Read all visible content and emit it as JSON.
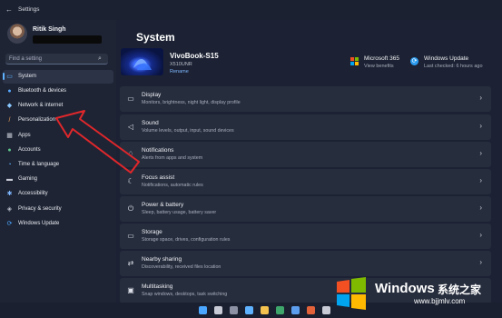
{
  "window": {
    "title": "Settings",
    "back_icon": "back-arrow-icon"
  },
  "user": {
    "name": "Ritik Singh"
  },
  "search": {
    "placeholder": "Find a setting"
  },
  "sidebar": {
    "items": [
      {
        "label": "System",
        "icon": "monitor-icon",
        "color": "#5fb2ff",
        "selected": true
      },
      {
        "label": "Bluetooth & devices",
        "icon": "bluetooth-icon",
        "color": "#59a9ff"
      },
      {
        "label": "Network & internet",
        "icon": "wifi-icon",
        "color": "#8bc7ff"
      },
      {
        "label": "Personalization",
        "icon": "brush-icon",
        "color": "#f2a35a"
      },
      {
        "label": "Apps",
        "icon": "apps-icon",
        "color": "#c8cbd6"
      },
      {
        "label": "Accounts",
        "icon": "person-icon",
        "color": "#5cc48a"
      },
      {
        "label": "Time & language",
        "icon": "globe-clock-icon",
        "color": "#5fb2ff"
      },
      {
        "label": "Gaming",
        "icon": "controller-icon",
        "color": "#c8cbd6"
      },
      {
        "label": "Accessibility",
        "icon": "accessibility-icon",
        "color": "#7fb7ff"
      },
      {
        "label": "Privacy & security",
        "icon": "shield-icon",
        "color": "#b8bcc8"
      },
      {
        "label": "Windows Update",
        "icon": "update-icon",
        "color": "#4aa6ff"
      }
    ]
  },
  "main": {
    "title": "System",
    "device": {
      "name": "VivoBook-S15",
      "model": "X510UNR",
      "rename": "Rename"
    },
    "microsoft365": {
      "title": "Microsoft 365",
      "subtitle": "View benefits"
    },
    "windows_update": {
      "title": "Windows Update",
      "subtitle": "Last checked: 6 hours ago"
    },
    "cards": [
      {
        "title": "Display",
        "subtitle": "Monitors, brightness, night light, display profile",
        "icon": "monitor-icon"
      },
      {
        "title": "Sound",
        "subtitle": "Volume levels, output, input, sound devices",
        "icon": "speaker-icon"
      },
      {
        "title": "Notifications",
        "subtitle": "Alerts from apps and system",
        "icon": "bell-icon"
      },
      {
        "title": "Focus assist",
        "subtitle": "Notifications, automatic rules",
        "icon": "moon-icon"
      },
      {
        "title": "Power & battery",
        "subtitle": "Sleep, battery usage, battery saver",
        "icon": "power-icon"
      },
      {
        "title": "Storage",
        "subtitle": "Storage space, drives, configuration rules",
        "icon": "drive-icon"
      },
      {
        "title": "Nearby sharing",
        "subtitle": "Discoverability, received files location",
        "icon": "share-icon"
      },
      {
        "title": "Multitasking",
        "subtitle": "Snap windows, desktops, task switching",
        "icon": "multitask-icon"
      }
    ]
  },
  "watermark": {
    "name": "Windows",
    "cn": "系统之家",
    "url": "www.bjjmlv.com"
  },
  "colors": {
    "accent": "#5fb2ff",
    "arrow": "#e0272b"
  }
}
